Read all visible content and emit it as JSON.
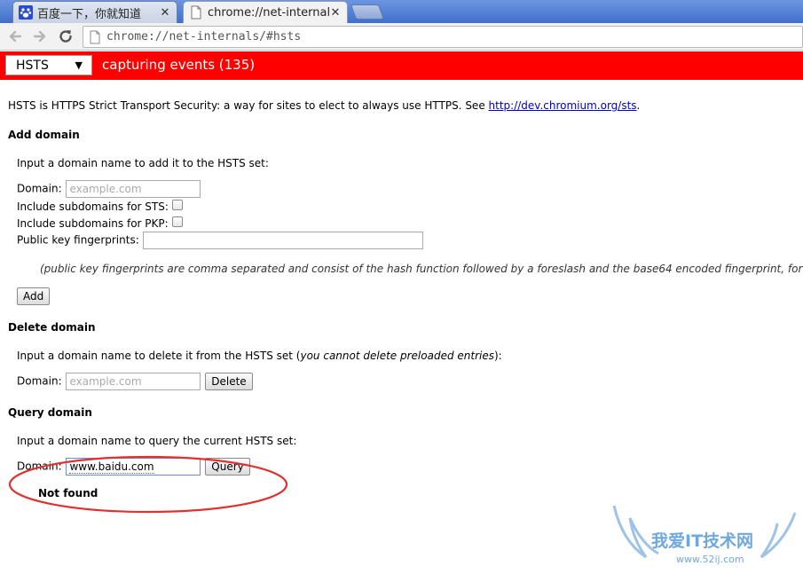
{
  "tabs": [
    {
      "title": "百度一下，你就知道",
      "close": "✕",
      "active": false,
      "icon": "baidu-paw-icon"
    },
    {
      "title": "chrome://net-internals",
      "close": "✕",
      "active": true,
      "icon": "page-icon"
    }
  ],
  "toolbar": {
    "url": "chrome://net-internals/#hsts"
  },
  "net_header": {
    "selected_tab": "HSTS",
    "status": "capturing events (135)",
    "color": "#ff0000"
  },
  "intro": {
    "text": "HSTS is HTTPS Strict Transport Security: a way for sites to elect to always use HTTPS. See ",
    "link": "http://dev.chromium.org/sts",
    "after_link": "."
  },
  "add_domain": {
    "heading": "Add domain",
    "instruction": "Input a domain name to add it to the HSTS set:",
    "domain_label": "Domain:",
    "domain_placeholder": "example.com",
    "sts_label": "Include subdomains for STS:",
    "pkp_label": "Include subdomains for PKP:",
    "fingerprints_label": "Public key fingerprints:",
    "fingerprints_value": "",
    "note": "(public key fingerprints are comma separated and consist of the hash function followed by a foreslash and the base64 encoded fingerprint, for example sha",
    "add_button": "Add"
  },
  "delete_domain": {
    "heading": "Delete domain",
    "instruction_pre": "Input a domain name to delete it from the HSTS set (",
    "instruction_em": "you cannot delete preloaded entries",
    "instruction_post": "):",
    "domain_label": "Domain:",
    "domain_placeholder": "example.com",
    "delete_button": "Delete"
  },
  "query_domain": {
    "heading": "Query domain",
    "instruction": "Input a domain name to query the current HSTS set:",
    "domain_label": "Domain:",
    "domain_value": "www.baidu.com",
    "query_button": "Query",
    "result": "Not found"
  },
  "annotation": {
    "color": "#e03030"
  },
  "watermark": {
    "text": "我爱IT技术网",
    "url": "www.52ij.com",
    "color": "#6fa8dc"
  }
}
